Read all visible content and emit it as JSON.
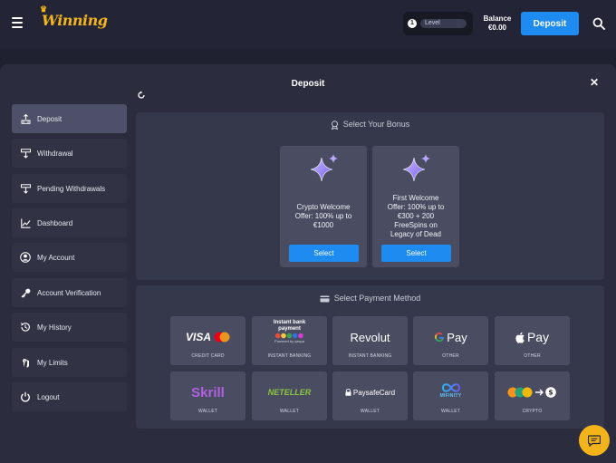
{
  "header": {
    "logo": "Winning",
    "level_number": "1",
    "level_label": "Level",
    "balance_label": "Balance",
    "balance_value": "€0.00",
    "deposit_label": "Deposit"
  },
  "modal": {
    "title": "Deposit"
  },
  "sidebar": {
    "items": [
      {
        "label": "Deposit",
        "icon": "deposit-icon",
        "active": true
      },
      {
        "label": "Withdrawal",
        "icon": "withdrawal-icon"
      },
      {
        "label": "Pending Withdrawals",
        "icon": "pending-withdrawal-icon"
      },
      {
        "label": "Dashboard",
        "icon": "chart-icon"
      },
      {
        "label": "My Account",
        "icon": "user-icon"
      },
      {
        "label": "Account Verification",
        "icon": "key-icon"
      },
      {
        "label": "My History",
        "icon": "history-icon"
      },
      {
        "label": "My Limits",
        "icon": "hand-icon"
      },
      {
        "label": "Logout",
        "icon": "power-icon"
      }
    ]
  },
  "bonus": {
    "heading": "Select Your Bonus",
    "cards": [
      {
        "text": [
          "Crypto Welcome",
          "Offer: 100% up to",
          "€1000"
        ],
        "button": "Select"
      },
      {
        "text": [
          "First Welcome",
          "Offer: 100% up to",
          "€300 + 200",
          "FreeSpins on",
          "Legacy of Dead"
        ],
        "button": "Select"
      }
    ]
  },
  "payment": {
    "heading": "Select Payment Method",
    "methods": [
      {
        "name": "VISA",
        "label": "CREDIT CARD"
      },
      {
        "name": "Instant bank payment",
        "sub": "Powered by yaspa",
        "label": "INSTANT BANKING"
      },
      {
        "name": "Revolut",
        "label": "INSTANT BANKING"
      },
      {
        "name": "Pay",
        "label": "OTHER"
      },
      {
        "name": "Pay",
        "label": "OTHER"
      },
      {
        "name": "Skrill",
        "label": "WALLET"
      },
      {
        "name": "NETELLER",
        "label": "WALLET"
      },
      {
        "name": "PaysafeCard",
        "label": "WALLET"
      },
      {
        "name": "MIFINITY",
        "label": "WALLET"
      },
      {
        "name": "",
        "label": "CRYPTO"
      }
    ]
  },
  "colors": {
    "accent": "#1d8bf0",
    "brand": "#f3b41b",
    "background": "#1f2130",
    "panel": "#35374a"
  }
}
